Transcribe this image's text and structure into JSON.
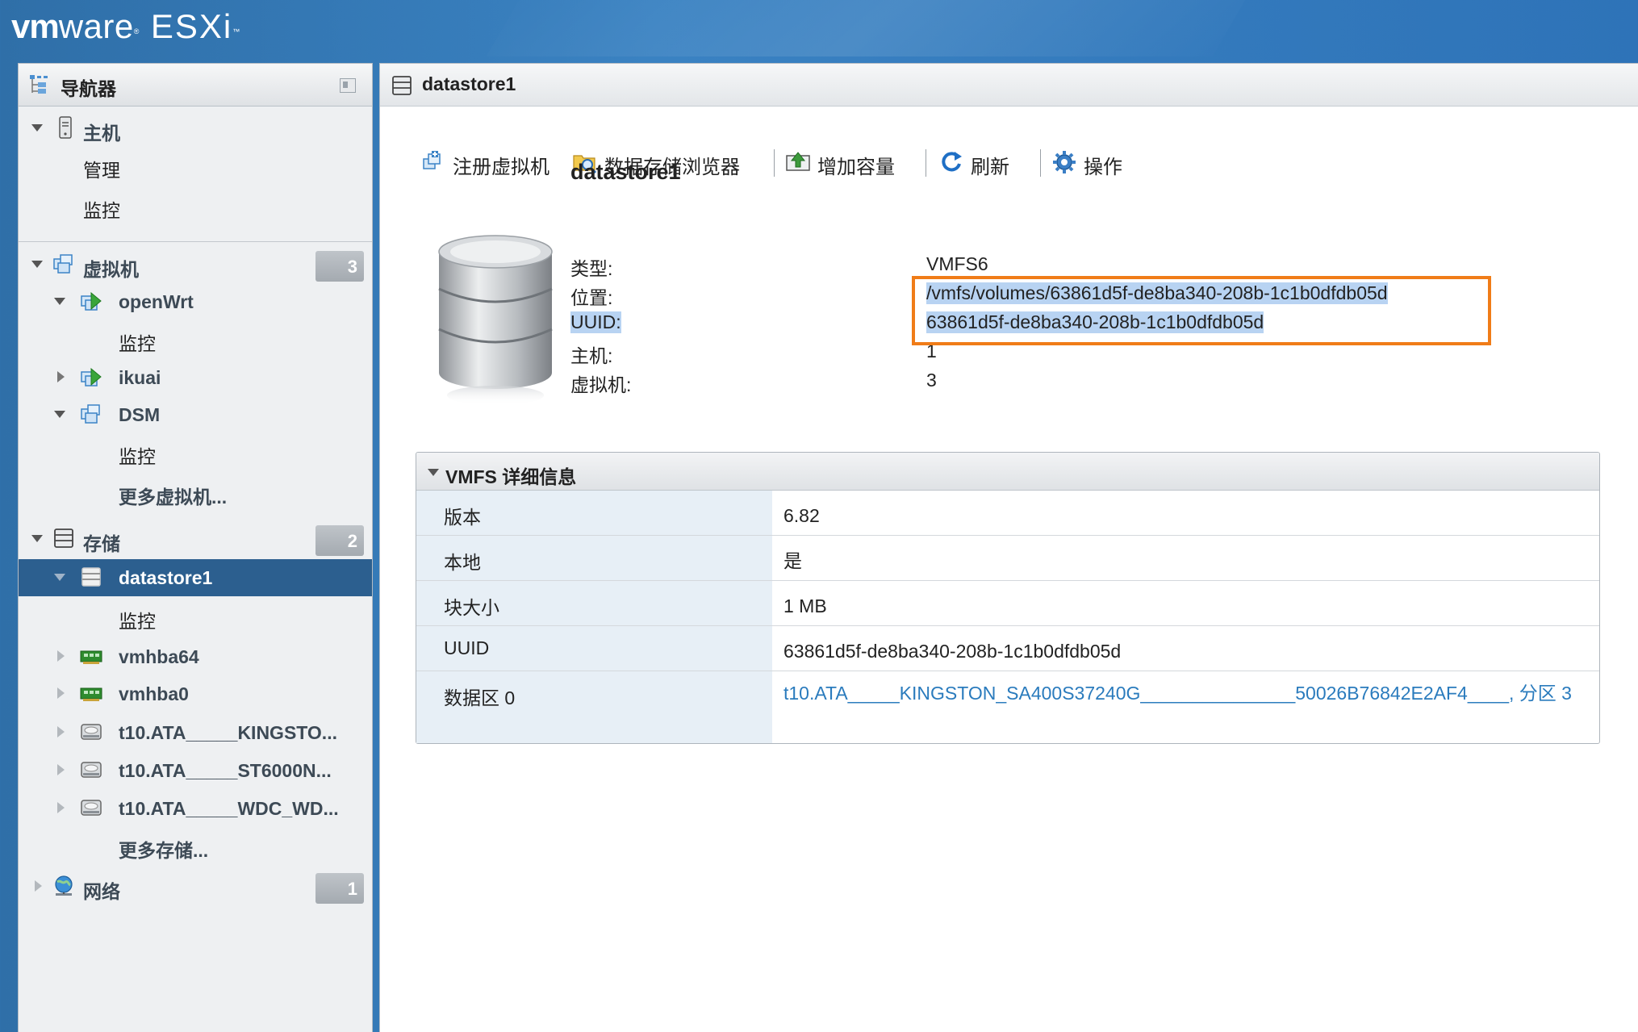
{
  "header": {
    "logo_vm": "vm",
    "logo_ware": "ware",
    "logo_reg": "®",
    "logo_product": "ESXi",
    "logo_tm": "™"
  },
  "navigator": {
    "title": "导航器",
    "host": {
      "label": "主机",
      "children": [
        "管理",
        "监控"
      ]
    },
    "vms": {
      "label": "虚拟机",
      "count": "3",
      "items": [
        {
          "label": "openWrt",
          "child": "监控"
        },
        {
          "label": "ikuai"
        },
        {
          "label": "DSM",
          "child": "监控"
        }
      ],
      "more": "更多虚拟机..."
    },
    "storage": {
      "label": "存储",
      "count": "2",
      "selected": "datastore1",
      "selected_child": "监控",
      "items": [
        "vmhba64",
        "vmhba0",
        "t10.ATA_____KINGSTO...",
        "t10.ATA_____ST6000N...",
        "t10.ATA_____WDC_WD..."
      ],
      "more": "更多存储..."
    },
    "network": {
      "label": "网络",
      "count": "1"
    }
  },
  "main": {
    "title": "datastore1",
    "toolbar": {
      "register_vm": "注册虚拟机",
      "datastore_browser": "数据存储浏览器",
      "increase_capacity": "增加容量",
      "refresh": "刷新",
      "actions": "操作"
    },
    "summary": {
      "name": "datastore1",
      "type_label": "类型:",
      "type_value": "VMFS6",
      "location_label": "位置:",
      "location_value": "/vmfs/volumes/63861d5f-de8ba340-208b-1c1b0dfdb05d",
      "uuid_label": "UUID:",
      "uuid_value": "63861d5f-de8ba340-208b-1c1b0dfdb05d",
      "hosts_label": "主机:",
      "hosts_value": "1",
      "vms_label": "虚拟机:",
      "vms_value": "3"
    },
    "vmfs": {
      "title": "VMFS 详细信息",
      "rows": [
        {
          "key": "版本",
          "value": "6.82"
        },
        {
          "key": "本地",
          "value": "是"
        },
        {
          "key": "块大小",
          "value": "1 MB"
        },
        {
          "key": "UUID",
          "value": "63861d5f-de8ba340-208b-1c1b0dfdb05d"
        },
        {
          "key": "数据区 0",
          "value": "t10.ATA_____KINGSTON_SA400S37240G_______________50026B76842E2AF4____, 分区 3"
        }
      ]
    }
  },
  "colors": {
    "header_blue": "#3a82c2",
    "selected_row": "#2c5f8f",
    "highlight_box": "#f07c18",
    "link": "#2a7bbd"
  }
}
